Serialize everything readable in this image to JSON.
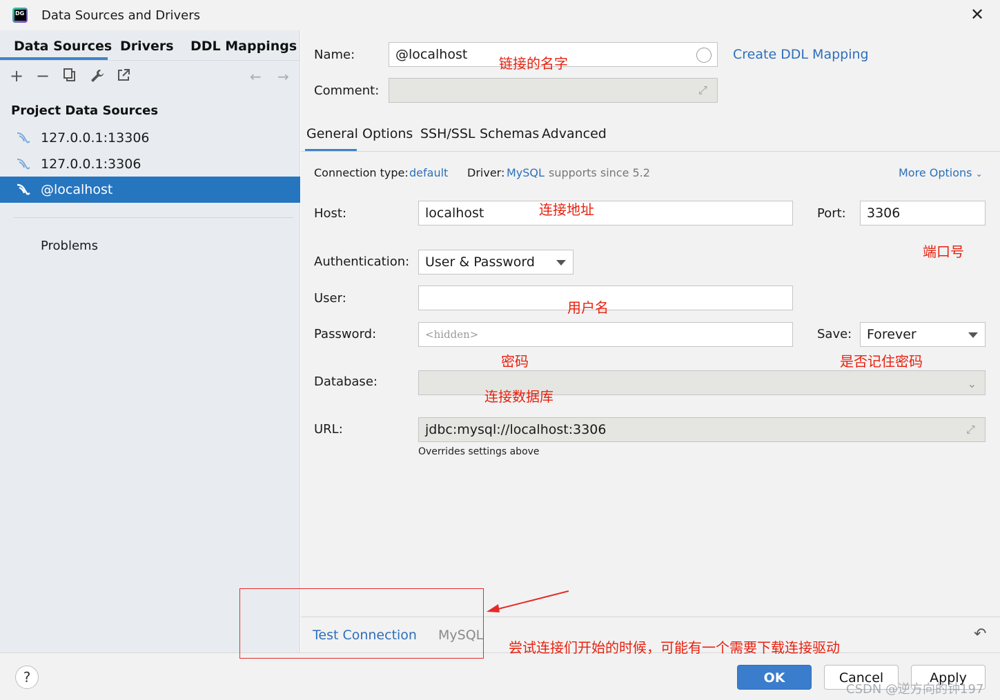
{
  "window": {
    "title": "Data Sources and Drivers"
  },
  "left_tabs": [
    "Data Sources",
    "Drivers",
    "DDL Mappings"
  ],
  "toolbar": {
    "add_icon": "plus-icon",
    "remove_icon": "minus-icon",
    "duplicate_icon": "copy-icon",
    "properties_icon": "wrench-icon",
    "export_icon": "external-link-icon",
    "back_icon": "arrow-left-icon",
    "forward_icon": "arrow-right-icon"
  },
  "project_data_sources": {
    "title": "Project Data Sources",
    "items": [
      {
        "label": "127.0.0.1:13306",
        "selected": false
      },
      {
        "label": "127.0.0.1:3306",
        "selected": false
      },
      {
        "label": "@localhost",
        "selected": true
      }
    ]
  },
  "problems_label": "Problems",
  "form": {
    "name_label": "Name:",
    "name_value": "@localhost",
    "create_ddl_link": "Create DDL Mapping",
    "comment_label": "Comment:",
    "tabs": [
      "General",
      "Options",
      "SSH/SSL",
      "Schemas",
      "Advanced"
    ],
    "connection_type_label": "Connection type:",
    "connection_type_value": "default",
    "driver_label": "Driver:",
    "driver_value": "MySQL",
    "driver_note": "supports since 5.2",
    "more_options": "More Options",
    "host_label": "Host:",
    "host_value": "localhost",
    "port_label": "Port:",
    "port_value": "3306",
    "auth_label": "Authentication:",
    "auth_value": "User & Password",
    "user_label": "User:",
    "user_value": "",
    "password_label": "Password:",
    "password_placeholder": "<hidden>",
    "save_label": "Save:",
    "save_value": "Forever",
    "database_label": "Database:",
    "url_label": "URL:",
    "url_value": "jdbc:mysql://localhost:3306",
    "url_note": "Overrides settings above"
  },
  "bottom_bar": {
    "test_connection": "Test Connection",
    "driver_name": "MySQL",
    "reset_icon": "undo-icon"
  },
  "footer": {
    "help": "?",
    "ok": "OK",
    "cancel": "Cancel",
    "apply": "Apply"
  },
  "annotations": {
    "name": "链接的名字",
    "host": "连接地址",
    "port": "端口号",
    "user": "用户名",
    "password": "密码",
    "save": "是否记住密码",
    "database": "连接数据库",
    "test": "尝试连接们开始的时候，可能有一个需要下载连接驱动"
  },
  "watermark": "CSDN @逆方向的钟197",
  "colors": {
    "selection": "#2675bf",
    "link": "#2c6fbb",
    "primary_button": "#3a7dcd",
    "annotation": "#e8200e"
  }
}
